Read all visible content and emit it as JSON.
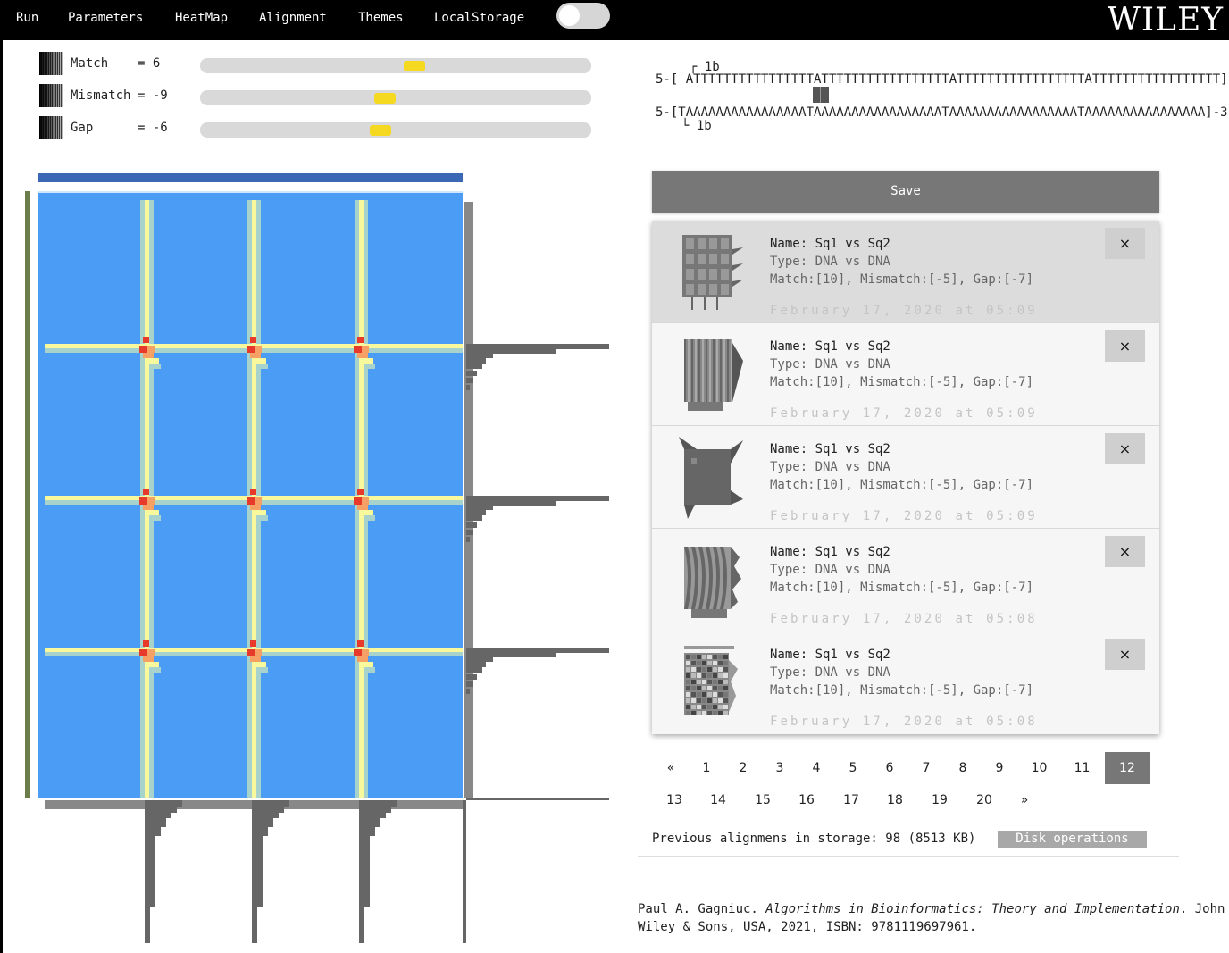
{
  "nav": {
    "items": [
      "Run",
      "Parameters",
      "HeatMap",
      "Alignment",
      "Themes",
      "LocalStorage"
    ],
    "logo": "WILEY"
  },
  "parameters": [
    {
      "label": "Match",
      "value": "= 6",
      "fraction": 0.55
    },
    {
      "label": "Mismatch",
      "value": "= -9",
      "fraction": 0.47
    },
    {
      "label": "Gap",
      "value": "= -6",
      "fraction": 0.46
    }
  ],
  "alignment": {
    "top_marker": "1b",
    "top_sequence": "5-[ ATTTTTTTTTTTTTTTTATTTTTTTTTTTTTTTTTATTTTTTTTTTTTTTTTTATTTTTTTTTTTTTTTTT]-3",
    "bottom_sequence": "5-[TAAAAAAAAAAAAAAAATAAAAAAAAAAAAAAAAATAAAAAAAAAAAAAAAAATAAAAAAAAAAAAAAAA]-3",
    "bottom_marker": "1b"
  },
  "save_label": "Save",
  "saved_alignments": [
    {
      "name": "Name: Sq1 vs Sq2",
      "type": "Type: DNA vs DNA",
      "params": "Match:[10], Mismatch:[-5], Gap:[-7]",
      "date": "February 17, 2020 at 05:09",
      "delete": "×",
      "thumb": "grid"
    },
    {
      "name": "Name: Sq1 vs Sq2",
      "type": "Type: DNA vs DNA",
      "params": "Match:[10], Mismatch:[-5], Gap:[-7]",
      "date": "February 17, 2020 at 05:09",
      "delete": "×",
      "thumb": "diagonal"
    },
    {
      "name": "Name: Sq1 vs Sq2",
      "type": "Type: DNA vs DNA",
      "params": "Match:[10], Mismatch:[-5], Gap:[-7]",
      "date": "February 17, 2020 at 05:09",
      "delete": "×",
      "thumb": "box"
    },
    {
      "name": "Name: Sq1 vs Sq2",
      "type": "Type: DNA vs DNA",
      "params": "Match:[10], Mismatch:[-5], Gap:[-7]",
      "date": "February 17, 2020 at 05:08",
      "delete": "×",
      "thumb": "wave"
    },
    {
      "name": "Name: Sq1 vs Sq2",
      "type": "Type: DNA vs DNA",
      "params": "Match:[10], Mismatch:[-5], Gap:[-7]",
      "date": "February 17, 2020 at 05:08",
      "delete": "×",
      "thumb": "noise"
    }
  ],
  "pagination": {
    "row1": [
      "«",
      "1",
      "2",
      "3",
      "4",
      "5",
      "6",
      "7",
      "8",
      "9",
      "10",
      "11",
      "12"
    ],
    "row2": [
      "13",
      "14",
      "15",
      "16",
      "17",
      "18",
      "19",
      "20",
      "»"
    ],
    "current": "12"
  },
  "storage_text": "Previous alignmens in storage: 98 (8513 KB)",
  "disk_label": "Disk operations",
  "citation": {
    "author": "Paul A. Gagniuc. ",
    "title": "Algorithms in Bioinformatics: Theory and Implementation",
    "rest": ". John",
    "line2": "Wiley & Sons, USA, 2021, ISBN: 9781119697961."
  },
  "colors": {
    "heatmap_background": "#4a9cf5",
    "heatmap_band": "#f8f89c",
    "heatmap_edge": "#a8d2cc",
    "heatmap_hot": "#e83a2a",
    "heatmap_warm": "#f5a064",
    "histogram": "#666666",
    "sequence_bar": "#3b67b5",
    "sequence_side": "#6a7d4a"
  }
}
